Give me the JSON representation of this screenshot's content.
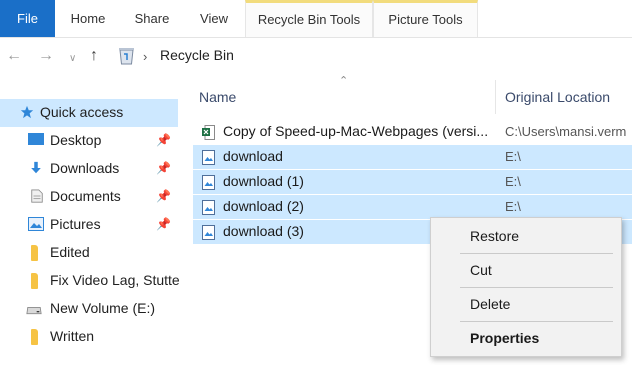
{
  "ribbon": {
    "tabs": [
      "File",
      "Home",
      "Share",
      "View",
      "Recycle Bin Tools",
      "Picture Tools"
    ]
  },
  "address": {
    "breadcrumb": "Recycle Bin"
  },
  "sidebar": {
    "items": [
      {
        "label": "Quick access",
        "icon": "star-icon"
      },
      {
        "label": "Desktop",
        "icon": "desktop-icon",
        "pinned": true
      },
      {
        "label": "Downloads",
        "icon": "download-arrow-icon",
        "pinned": true
      },
      {
        "label": "Documents",
        "icon": "document-icon",
        "pinned": true
      },
      {
        "label": "Pictures",
        "icon": "pictures-icon",
        "pinned": true
      },
      {
        "label": "Edited",
        "icon": "folder-icon"
      },
      {
        "label": "Fix Video Lag, Stutte",
        "icon": "folder-icon"
      },
      {
        "label": "New Volume (E:)",
        "icon": "drive-icon"
      },
      {
        "label": "Written",
        "icon": "folder-icon"
      }
    ]
  },
  "columns": {
    "name": "Name",
    "original_location": "Original Location"
  },
  "files": [
    {
      "name": "Copy of Speed-up-Mac-Webpages (versi...",
      "location": "C:\\Users\\mansi.verm",
      "icon": "excel-file-icon",
      "selected": false
    },
    {
      "name": "download",
      "location": "E:\\",
      "icon": "image-file-icon",
      "selected": true
    },
    {
      "name": "download (1)",
      "location": "E:\\",
      "icon": "image-file-icon",
      "selected": true
    },
    {
      "name": "download (2)",
      "location": "E:\\",
      "icon": "image-file-icon",
      "selected": true
    },
    {
      "name": "download (3)",
      "location": "",
      "icon": "image-file-icon",
      "selected": true
    }
  ],
  "context_menu": {
    "items": [
      "Restore",
      "Cut",
      "Delete",
      "Properties"
    ]
  },
  "colors": {
    "accent": "#1a6fc8",
    "selection": "#cce8ff",
    "contextual_tab": "#f2dc7d"
  }
}
